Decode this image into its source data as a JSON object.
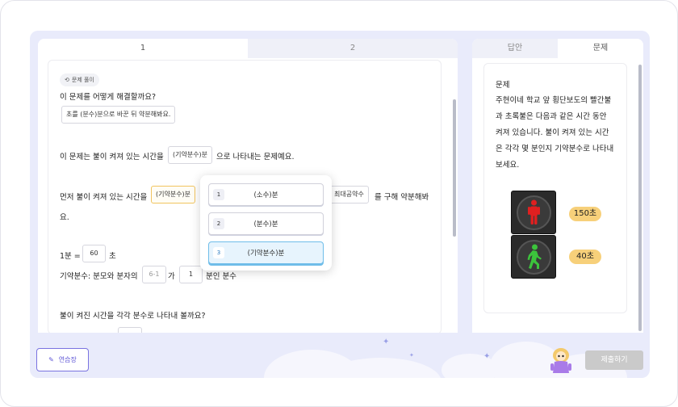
{
  "left_tabs": [
    "1",
    "2"
  ],
  "right_tabs": [
    "답안",
    "문제"
  ],
  "tag_label": "문제 풀이",
  "q1": "이 문제를 어떻게 해결할까요?",
  "hint_box": "초를 (분수)분으로 바꾼 뒤 약분해봐요.",
  "l2_pre": "이 문제는 불이 켜져 있는 시간을",
  "l2_box": "(기약분수)분",
  "l2_post": "으로 나타내는 문제예요.",
  "l3_pre": "먼저 불이 켜져 있는 시간을",
  "l3_box_selected": "(기약분수)분",
  "l3_box2": "최대공약수",
  "l3_post": "를 구해 약분해봐",
  "l3_cont": "요.",
  "eq_pre": "1분 =",
  "eq_value": "60",
  "eq_post": "초",
  "frac_pre": "기약분수: 분모와 분자의",
  "frac_box1": "6-1",
  "frac_mid": "가",
  "frac_box2": "1",
  "frac_post": "분인 분수",
  "q2": "불이 켜진 시간을 각각 분수로 나타내 볼까요?",
  "dropdown": [
    {
      "num": "1",
      "label": "(소수)분",
      "selected": false
    },
    {
      "num": "2",
      "label": "(분수)분",
      "selected": false
    },
    {
      "num": "3",
      "label": "(기약분수)분",
      "selected": true
    }
  ],
  "problem_title": "문제",
  "problem_lines": [
    "주현이네 학교 앞 횡단보도의 빨간불",
    "과 초록불은 다음과 같은 시간 동안",
    "켜져 있습니다. 불이 켜져 있는 시간",
    "은 각각 몇 분인지 기약분수로 나타내",
    "보세요."
  ],
  "red_badge": "150초",
  "green_badge": "40초",
  "practice_label": "연습장",
  "submit_label": "제출하기",
  "colors": {
    "accent": "#5d55d6",
    "selected_border": "#6fbde9",
    "highlight": "#f1c45e",
    "badge": "#f7d07a"
  }
}
